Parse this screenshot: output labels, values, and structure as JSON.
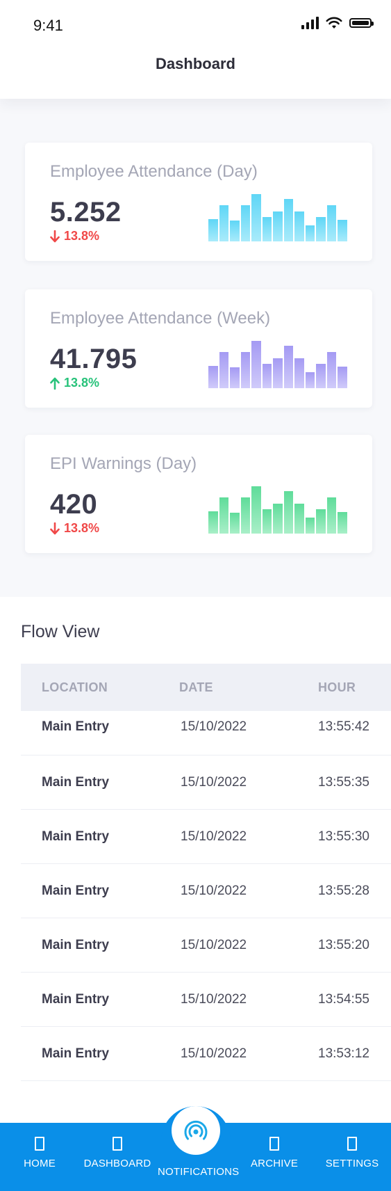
{
  "status_bar": {
    "time": "9:41"
  },
  "header": {
    "title": "Dashboard"
  },
  "cards": [
    {
      "title": "Employee Attendance (Day)",
      "value": "5.252",
      "delta": "13.8%",
      "trend": "down",
      "bar_levels": [
        0.45,
        0.72,
        0.42,
        0.72,
        0.95,
        0.48,
        0.6,
        0.85,
        0.6,
        0.32,
        0.48,
        0.72,
        0.43
      ],
      "color_top": "#5fd6f6",
      "color_bottom": "#a9ebfb"
    },
    {
      "title": "Employee Attendance (Week)",
      "value": "41.795",
      "delta": "13.8%",
      "trend": "up",
      "bar_levels": [
        0.45,
        0.72,
        0.42,
        0.72,
        0.95,
        0.48,
        0.6,
        0.85,
        0.6,
        0.32,
        0.48,
        0.72,
        0.43
      ],
      "color_top": "#a49af3",
      "color_bottom": "#d0cbfa"
    },
    {
      "title": "EPI Warnings (Day)",
      "value": "420",
      "delta": "13.8%",
      "trend": "down",
      "bar_levels": [
        0.45,
        0.72,
        0.42,
        0.72,
        0.95,
        0.48,
        0.6,
        0.85,
        0.6,
        0.32,
        0.48,
        0.72,
        0.43
      ],
      "color_top": "#5fdc9a",
      "color_bottom": "#a9efc8"
    }
  ],
  "flow_view": {
    "title": "Flow View",
    "columns": {
      "location": "LOCATION",
      "date": "DATE",
      "hour": "HOUR"
    },
    "rows": [
      {
        "location": "Main Entry",
        "date": "15/10/2022",
        "hour": "13:55:42"
      },
      {
        "location": "Main Entry",
        "date": "15/10/2022",
        "hour": "13:55:35"
      },
      {
        "location": "Main Entry",
        "date": "15/10/2022",
        "hour": "13:55:30"
      },
      {
        "location": "Main Entry",
        "date": "15/10/2022",
        "hour": "13:55:28"
      },
      {
        "location": "Main Entry",
        "date": "15/10/2022",
        "hour": "13:55:20"
      },
      {
        "location": "Main Entry",
        "date": "15/10/2022",
        "hour": "13:54:55"
      },
      {
        "location": "Main Entry",
        "date": "15/10/2022",
        "hour": "13:53:12"
      }
    ]
  },
  "bottom_nav": {
    "items": [
      {
        "label": "HOME",
        "icon": "home-icon"
      },
      {
        "label": "DASHBOARD",
        "icon": "dashboard-icon"
      },
      {
        "label": "NOTIFICATIONS",
        "icon": "broadcast-icon"
      },
      {
        "label": "ARCHIVE",
        "icon": "archive-icon"
      },
      {
        "label": "SETTINGS",
        "icon": "settings-icon"
      }
    ],
    "color": "#0a8fe8"
  },
  "colors": {
    "down": "#f04848",
    "up": "#27c27a"
  }
}
